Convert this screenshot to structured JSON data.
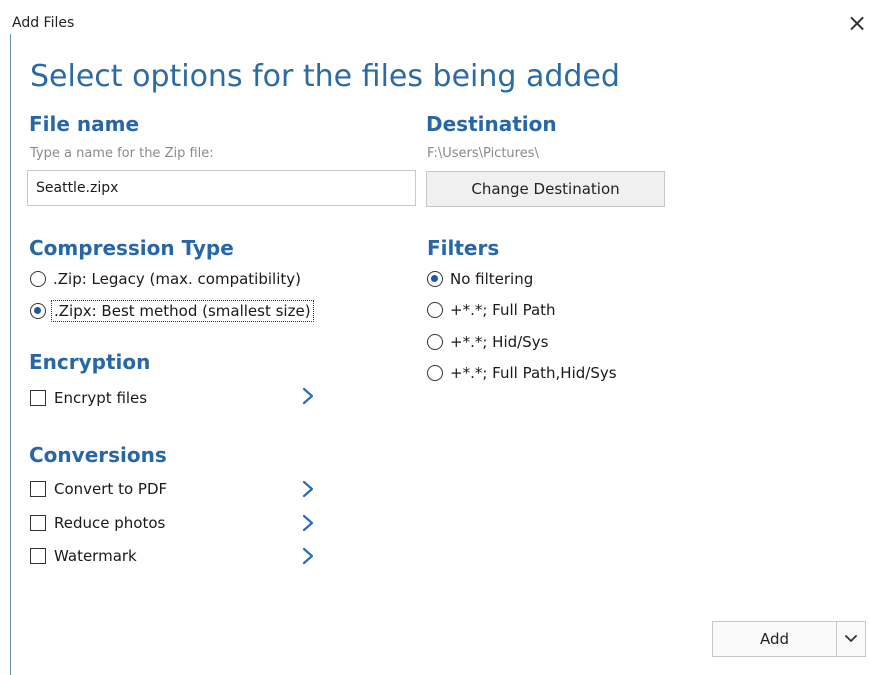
{
  "window": {
    "title": "Add Files",
    "close_glyph": "×"
  },
  "heading": "Select options for the files being added",
  "file_name": {
    "title": "File name",
    "hint": "Type a name for the Zip file:",
    "value": "Seattle.zipx"
  },
  "destination": {
    "title": "Destination",
    "path": "F:\\Users\\Pictures\\",
    "button_label": "Change Destination"
  },
  "compression": {
    "title": "Compression Type",
    "options": [
      {
        "label": ".Zip: Legacy (max. compatibility)",
        "selected": false
      },
      {
        "label": ".Zipx: Best method (smallest size)",
        "selected": true
      }
    ]
  },
  "filters": {
    "title": "Filters",
    "options": [
      {
        "label": "No filtering",
        "selected": true
      },
      {
        "label": "+*.*; Full Path",
        "selected": false
      },
      {
        "label": "+*.*; Hid/Sys",
        "selected": false
      },
      {
        "label": "+*.*; Full Path,Hid/Sys",
        "selected": false
      }
    ]
  },
  "encryption": {
    "title": "Encryption",
    "items": [
      {
        "label": "Encrypt files",
        "checked": false
      }
    ]
  },
  "conversions": {
    "title": "Conversions",
    "items": [
      {
        "label": "Convert to PDF",
        "checked": false
      },
      {
        "label": "Reduce photos",
        "checked": false
      },
      {
        "label": "Watermark",
        "checked": false
      }
    ]
  },
  "footer": {
    "add_label": "Add"
  },
  "icons": {
    "close": "close-icon",
    "chevron_right": "chevron-right-icon",
    "chevron_down": "chevron-down-icon"
  },
  "colors": {
    "heading": "#2c6aa4",
    "section_title": "#2767a6",
    "chevron": "#2a6db5",
    "radio_dot": "#1f5aa0"
  }
}
